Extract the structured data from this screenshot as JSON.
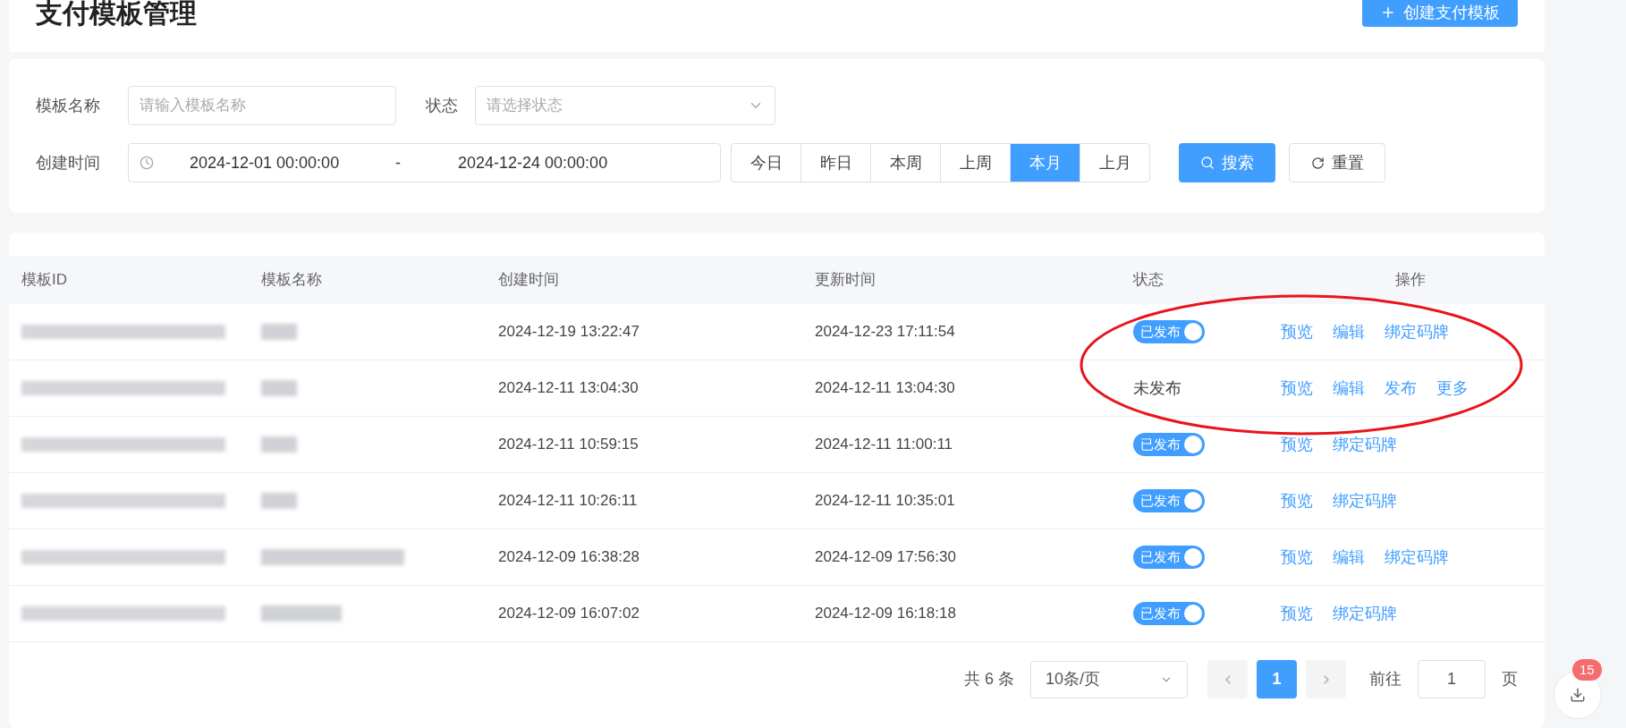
{
  "page": {
    "title": "支付模板管理",
    "create_button": "创建支付模板"
  },
  "filters": {
    "name_label": "模板名称",
    "name_placeholder": "请输入模板名称",
    "status_label": "状态",
    "status_placeholder": "请选择状态",
    "time_label": "创建时间",
    "start": "2024-12-01 00:00:00",
    "separator": "-",
    "end": "2024-12-24 00:00:00",
    "ranges": [
      {
        "label": "今日",
        "selected": false
      },
      {
        "label": "昨日",
        "selected": false
      },
      {
        "label": "本周",
        "selected": false
      },
      {
        "label": "上周",
        "selected": false
      },
      {
        "label": "本月",
        "selected": true
      },
      {
        "label": "上月",
        "selected": false
      }
    ],
    "search_button": "搜索",
    "reset_button": "重置"
  },
  "table": {
    "columns": [
      "模板ID",
      "模板名称",
      "创建时间",
      "更新时间",
      "状态",
      "操作"
    ],
    "rows": [
      {
        "created": "2024-12-19 13:22:47",
        "updated": "2024-12-23 17:11:54",
        "status": {
          "kind": "toggle",
          "label": "已发布",
          "on": true
        },
        "actions": [
          "预览",
          "编辑",
          "绑定码牌"
        ]
      },
      {
        "created": "2024-12-11 13:04:30",
        "updated": "2024-12-11 13:04:30",
        "status": {
          "kind": "text",
          "label": "未发布"
        },
        "actions": [
          "预览",
          "编辑",
          "发布",
          "更多"
        ]
      },
      {
        "created": "2024-12-11 10:59:15",
        "updated": "2024-12-11 11:00:11",
        "status": {
          "kind": "toggle",
          "label": "已发布",
          "on": true
        },
        "actions": [
          "预览",
          "绑定码牌"
        ]
      },
      {
        "created": "2024-12-11 10:26:11",
        "updated": "2024-12-11 10:35:01",
        "status": {
          "kind": "toggle",
          "label": "已发布",
          "on": true
        },
        "actions": [
          "预览",
          "绑定码牌"
        ]
      },
      {
        "created": "2024-12-09 16:38:28",
        "updated": "2024-12-09 17:56:30",
        "status": {
          "kind": "toggle",
          "label": "已发布",
          "on": true
        },
        "actions": [
          "预览",
          "编辑",
          "绑定码牌"
        ]
      },
      {
        "created": "2024-12-09 16:07:02",
        "updated": "2024-12-09 16:18:18",
        "status": {
          "kind": "toggle",
          "label": "已发布",
          "on": true
        },
        "actions": [
          "预览",
          "绑定码牌"
        ]
      }
    ]
  },
  "pagination": {
    "total": "共 6 条",
    "page_size": "10条/页",
    "pages": [
      {
        "label": "1",
        "selected": true
      }
    ],
    "goto_label": "前往",
    "goto_value": "1",
    "page_suffix": "页"
  },
  "download_badge": "15"
}
